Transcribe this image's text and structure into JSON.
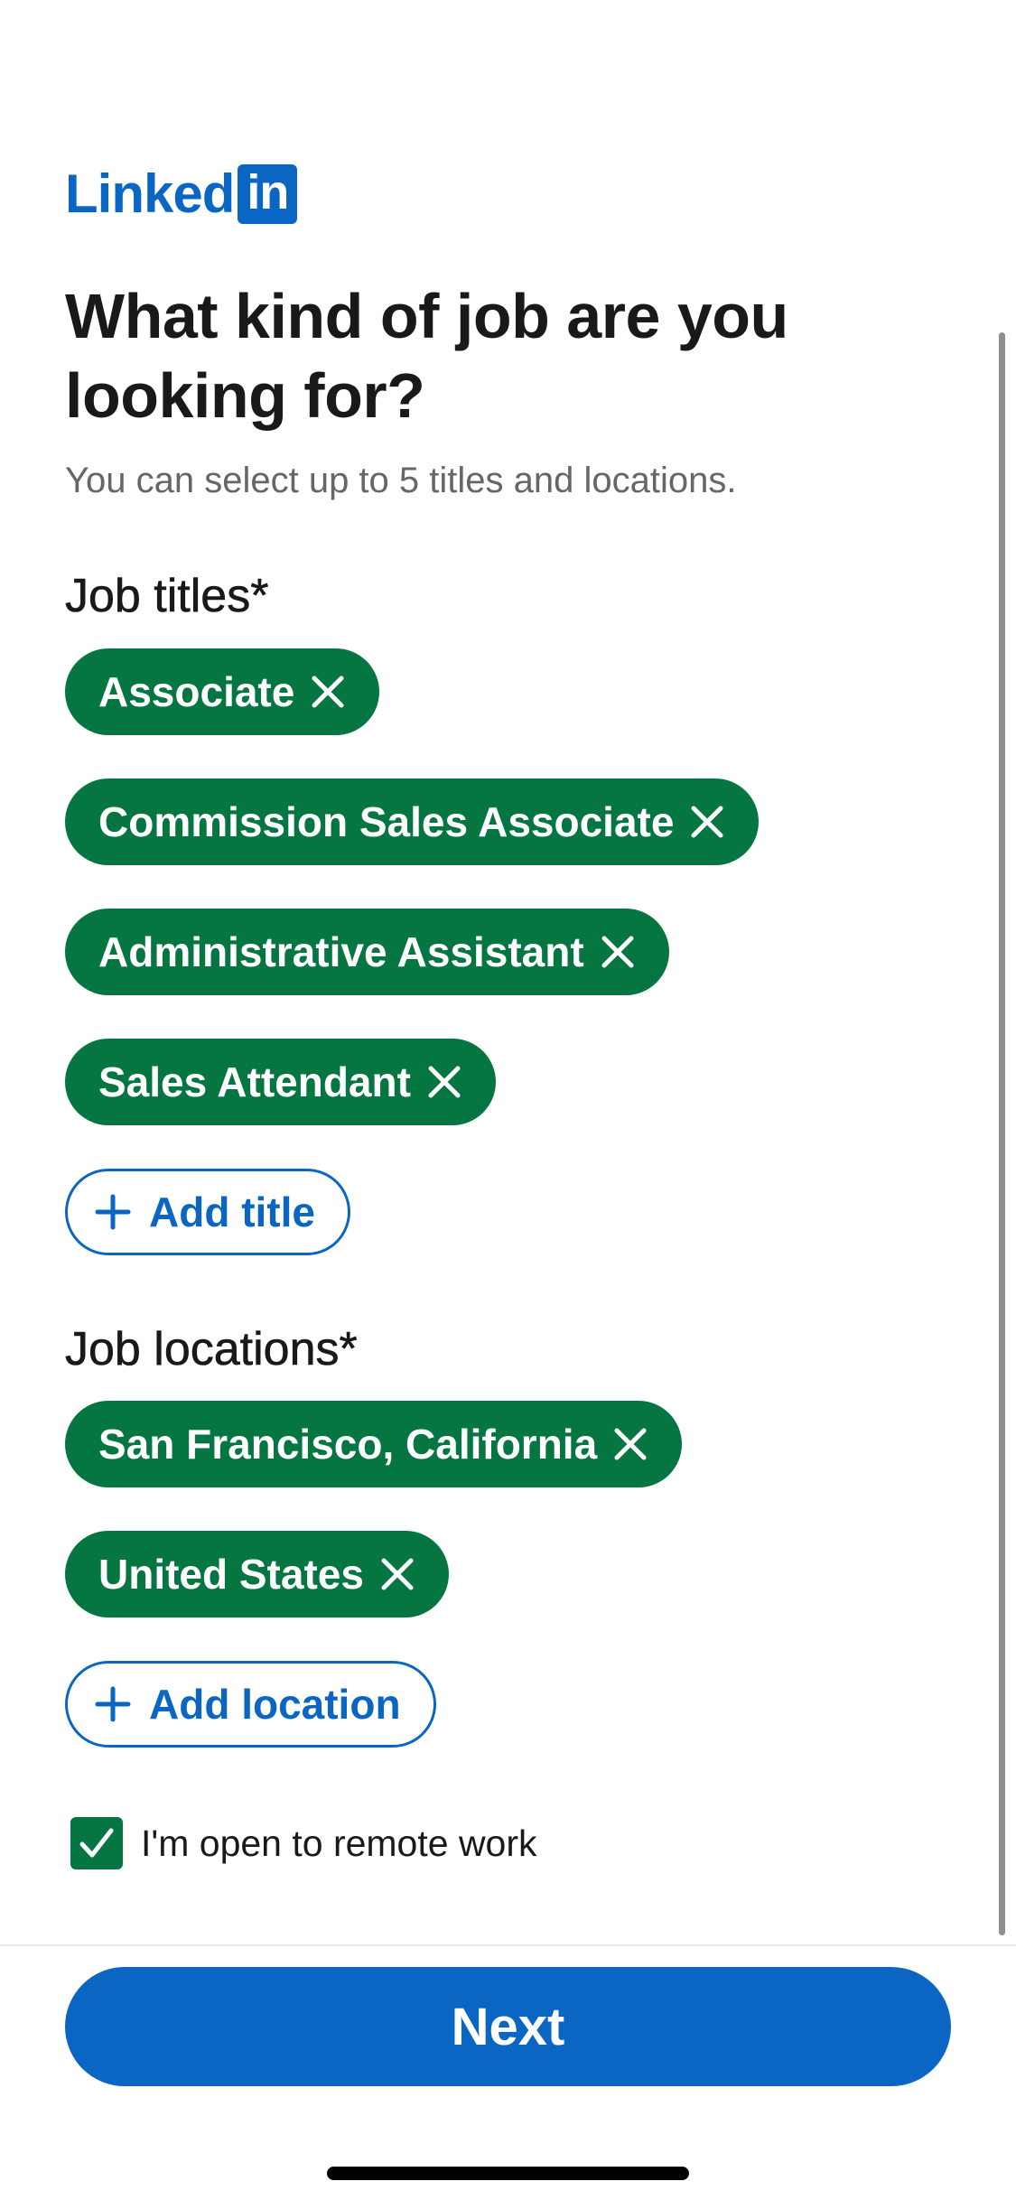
{
  "brand": {
    "logo_text": "Linked",
    "logo_box_text": "in",
    "accent_color": "#0a66c2",
    "selected_chip_color": "#057642"
  },
  "header": {
    "title": "What kind of job are you looking for?",
    "subtitle": "You can select up to 5 titles and locations."
  },
  "job_titles": {
    "label": "Job titles*",
    "chips": [
      {
        "label": "Associate",
        "icon": "close-icon"
      },
      {
        "label": "Commission Sales Associate",
        "icon": "close-icon"
      },
      {
        "label": "Administrative Assistant",
        "icon": "close-icon"
      },
      {
        "label": "Sales Attendant",
        "icon": "close-icon"
      }
    ],
    "add_label": "Add title",
    "add_icon": "plus-icon"
  },
  "job_locations": {
    "label": "Job locations*",
    "chips": [
      {
        "label": "San Francisco, California",
        "icon": "close-icon"
      },
      {
        "label": "United States",
        "icon": "close-icon"
      }
    ],
    "add_label": "Add location",
    "add_icon": "plus-icon"
  },
  "remote": {
    "label": "I'm open to remote work",
    "checked": true,
    "icon": "checkmark-icon"
  },
  "footer": {
    "next_label": "Next"
  }
}
